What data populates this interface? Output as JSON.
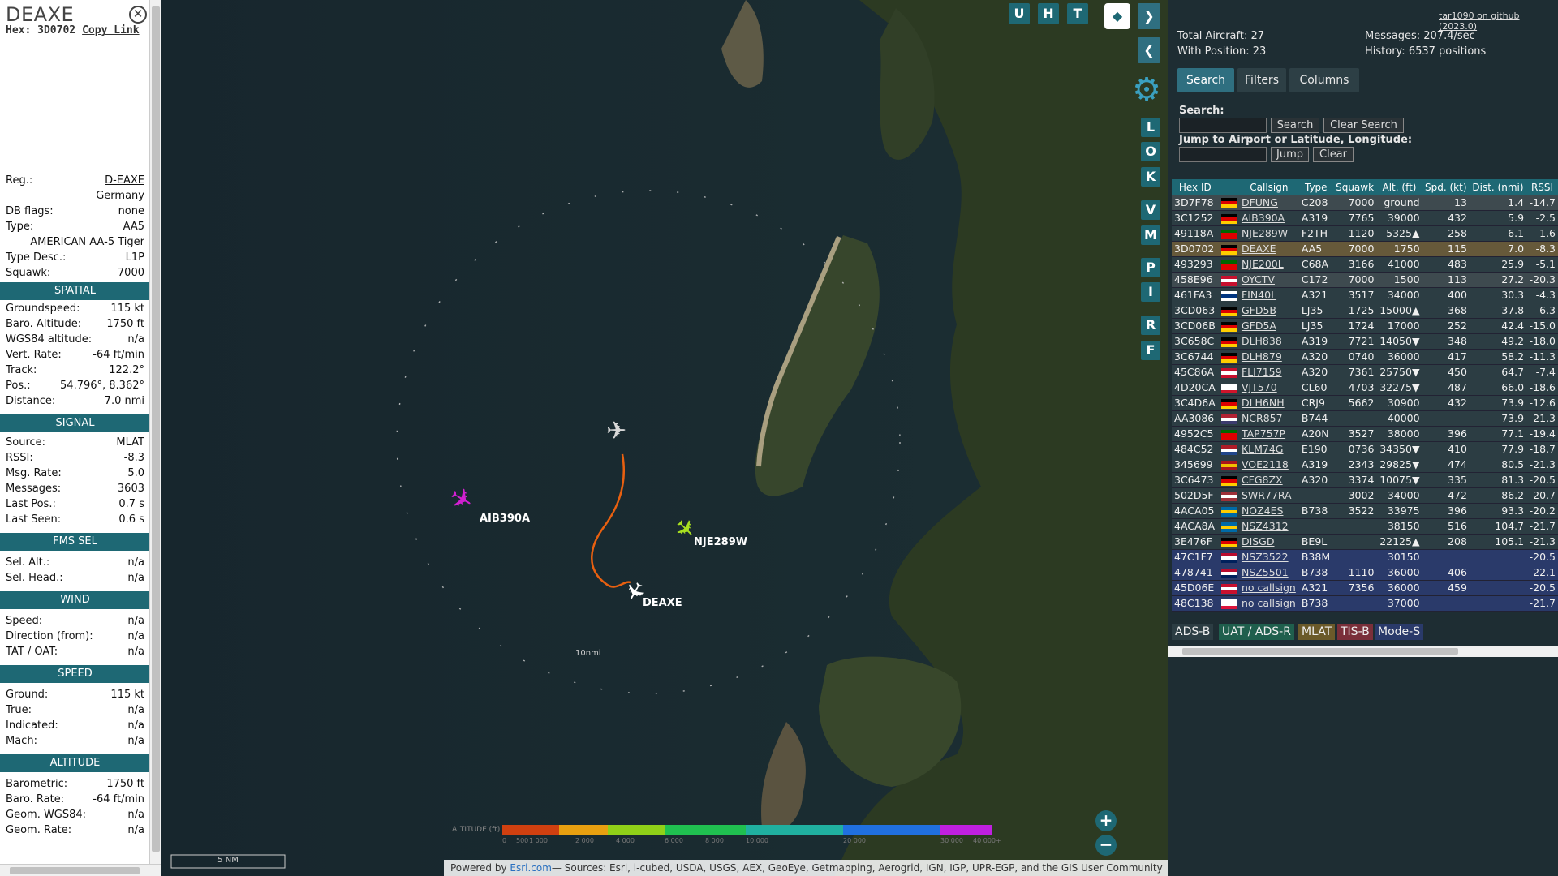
{
  "sidebar": {
    "title": "DEAXE",
    "hex_label": "Hex:",
    "hex": "3D0702",
    "copy_link": "Copy Link",
    "info": [
      {
        "k": "Reg.:",
        "v": "D-EAXE"
      },
      {
        "k": "",
        "v": "Germany"
      },
      {
        "k": "DB flags:",
        "v": "none"
      },
      {
        "k": "Type:",
        "v": "AA5"
      },
      {
        "k": "",
        "v": "AMERICAN AA-5 Tiger"
      },
      {
        "k": "Type Desc.:",
        "v": "L1P"
      },
      {
        "k": "Squawk:",
        "v": "7000"
      }
    ],
    "sections": {
      "spatial": "SPATIAL",
      "signal": "SIGNAL",
      "fms": "FMS SEL",
      "wind": "WIND",
      "speed": "SPEED",
      "altitude": "ALTITUDE"
    },
    "spatial": [
      {
        "k": "Groundspeed:",
        "v": "115 kt"
      },
      {
        "k": "Baro. Altitude:",
        "v": "1750 ft"
      },
      {
        "k": "WGS84 altitude:",
        "v": "n/a"
      },
      {
        "k": "Vert. Rate:",
        "v": "-64 ft/min"
      },
      {
        "k": "Track:",
        "v": "122.2°"
      },
      {
        "k": "Pos.:",
        "v": "54.796°, 8.362°"
      },
      {
        "k": "Distance:",
        "v": "7.0 nmi"
      }
    ],
    "signal": [
      {
        "k": "Source:",
        "v": "MLAT"
      },
      {
        "k": "RSSI:",
        "v": "-8.3"
      },
      {
        "k": "Msg. Rate:",
        "v": "5.0"
      },
      {
        "k": "Messages:",
        "v": "3603"
      },
      {
        "k": "Last Pos.:",
        "v": "0.7 s"
      },
      {
        "k": "Last Seen:",
        "v": "0.6 s"
      }
    ],
    "fms": [
      {
        "k": "Sel. Alt.:",
        "v": "n/a"
      },
      {
        "k": "Sel. Head.:",
        "v": "n/a"
      }
    ],
    "wind": [
      {
        "k": "Speed:",
        "v": "n/a"
      },
      {
        "k": "Direction (from):",
        "v": "n/a"
      },
      {
        "k": "TAT / OAT:",
        "v": "n/a"
      }
    ],
    "speed": [
      {
        "k": "Ground:",
        "v": "115 kt"
      },
      {
        "k": "True:",
        "v": "n/a"
      },
      {
        "k": "Indicated:",
        "v": "n/a"
      },
      {
        "k": "Mach:",
        "v": "n/a"
      }
    ],
    "altitude": [
      {
        "k": "Barometric:",
        "v": "1750 ft"
      },
      {
        "k": "Baro. Rate:",
        "v": "-64 ft/min"
      },
      {
        "k": "Geom. WGS84:",
        "v": "n/a"
      },
      {
        "k": "Geom. Rate:",
        "v": "n/a"
      }
    ]
  },
  "map": {
    "labels": {
      "aib": "AIB390A",
      "nje": "NJE289W",
      "deaxe": "DEAXE",
      "ring": "10nmi"
    },
    "top_buttons": [
      "U",
      "H",
      "T"
    ],
    "side_buttons": [
      "L",
      "O",
      "K",
      "V",
      "M",
      "P",
      "I",
      "R",
      "F"
    ],
    "scale": "5 NM",
    "alt_legend": {
      "title": "ALTITUDE (ft)",
      "ticks": [
        "0",
        "500",
        "1 000",
        "2 000",
        "4 000",
        "6 000",
        "8 000",
        "10 000",
        "20 000",
        "30 000",
        "40 000+"
      ]
    },
    "zoom_in": "+",
    "zoom_out": "−",
    "attrib_prefix": "Powered by ",
    "attrib_link": "Esri.com",
    "attrib_rest": "— Sources: Esri, i-cubed, USDA, USGS, AEX, GeoEye, Getmapping, Aerogrid, IGN, IGP, UPR-EGP, and the GIS User Community",
    "colors": {
      "aib": "#d020d0",
      "nje": "#a8e020",
      "deaxe": "#ffffff",
      "track": "#e86010"
    }
  },
  "panel": {
    "github": "tar1090 on github (2023.0)",
    "total": "Total Aircraft: 27",
    "withpos": "With Position: 23",
    "messages": "Messages: 207.4/sec",
    "history": "History: 6537 positions",
    "tabs": [
      "Search",
      "Filters",
      "Columns"
    ],
    "search_label": "Search:",
    "search_btn": "Search",
    "clear_search_btn": "Clear Search",
    "jump_label": "Jump to Airport or Latitude, Longitude:",
    "jump_btn": "Jump",
    "clear_btn": "Clear",
    "columns": [
      "Hex ID",
      "",
      "Callsign",
      "Type",
      "Squawk",
      "Alt. (ft)",
      "Spd. (kt)",
      "Dist. (nmi)",
      "RSSI"
    ],
    "rows": [
      {
        "hex": "3D7F78",
        "flag": "de",
        "cs": "DFUNG",
        "type": "C208",
        "sq": "7000",
        "alt": "ground",
        "spd": "13",
        "dist": "1.4",
        "rssi": "-14.7",
        "cls": "mlat"
      },
      {
        "hex": "3C1252",
        "flag": "de",
        "cs": "AIB390A",
        "type": "A319",
        "sq": "7765",
        "alt": "39000",
        "spd": "432",
        "dist": "5.9",
        "rssi": "-2.5",
        "cls": "adsb"
      },
      {
        "hex": "49118A",
        "flag": "pt",
        "cs": "NJE289W",
        "type": "F2TH",
        "sq": "1120",
        "alt": "5325▲",
        "spd": "258",
        "dist": "6.1",
        "rssi": "-1.6",
        "cls": "adsb"
      },
      {
        "hex": "3D0702",
        "flag": "de",
        "cs": "DEAXE",
        "type": "AA5",
        "sq": "7000",
        "alt": "1750",
        "spd": "115",
        "dist": "7.0",
        "rssi": "-8.3",
        "cls": "sel"
      },
      {
        "hex": "493293",
        "flag": "pt",
        "cs": "NJE200L",
        "type": "C68A",
        "sq": "3166",
        "alt": "41000",
        "spd": "483",
        "dist": "25.9",
        "rssi": "-5.1",
        "cls": "adsb"
      },
      {
        "hex": "458E96",
        "flag": "dk",
        "cs": "OYCTV",
        "type": "C172",
        "sq": "7000",
        "alt": "1500",
        "spd": "113",
        "dist": "27.2",
        "rssi": "-20.3",
        "cls": "mlat"
      },
      {
        "hex": "461FA3",
        "flag": "fi",
        "cs": "FIN40L",
        "type": "A321",
        "sq": "3517",
        "alt": "34000",
        "spd": "400",
        "dist": "30.3",
        "rssi": "-4.3",
        "cls": "adsb"
      },
      {
        "hex": "3CD063",
        "flag": "de",
        "cs": "GFD5B",
        "type": "LJ35",
        "sq": "1725",
        "alt": "15000▲",
        "spd": "368",
        "dist": "37.8",
        "rssi": "-6.3",
        "cls": "adsb"
      },
      {
        "hex": "3CD06B",
        "flag": "de",
        "cs": "GFD5A",
        "type": "LJ35",
        "sq": "1724",
        "alt": "17000",
        "spd": "252",
        "dist": "42.4",
        "rssi": "-15.0",
        "cls": "adsb"
      },
      {
        "hex": "3C658C",
        "flag": "de",
        "cs": "DLH838",
        "type": "A319",
        "sq": "7721",
        "alt": "14050▼",
        "spd": "348",
        "dist": "49.2",
        "rssi": "-18.0",
        "cls": "adsb"
      },
      {
        "hex": "3C6744",
        "flag": "de",
        "cs": "DLH879",
        "type": "A320",
        "sq": "0740",
        "alt": "36000",
        "spd": "417",
        "dist": "58.2",
        "rssi": "-11.3",
        "cls": "adsb"
      },
      {
        "hex": "45C86A",
        "flag": "dk",
        "cs": "FLI7159",
        "type": "A320",
        "sq": "7361",
        "alt": "25750▼",
        "spd": "450",
        "dist": "64.7",
        "rssi": "-7.4",
        "cls": "adsb"
      },
      {
        "hex": "4D20CA",
        "flag": "mt",
        "cs": "VJT570",
        "type": "CL60",
        "sq": "4703",
        "alt": "32275▼",
        "spd": "487",
        "dist": "66.0",
        "rssi": "-18.6",
        "cls": "adsb"
      },
      {
        "hex": "3C4D6A",
        "flag": "de",
        "cs": "DLH6NH",
        "type": "CRJ9",
        "sq": "5662",
        "alt": "30900",
        "spd": "432",
        "dist": "73.9",
        "rssi": "-12.6",
        "cls": "adsb"
      },
      {
        "hex": "AA3086",
        "flag": "us",
        "cs": "NCR857",
        "type": "B744",
        "sq": "",
        "alt": "40000",
        "spd": "",
        "dist": "73.9",
        "rssi": "-21.3",
        "cls": "adsb"
      },
      {
        "hex": "4952C5",
        "flag": "pt",
        "cs": "TAP757P",
        "type": "A20N",
        "sq": "3527",
        "alt": "38000",
        "spd": "396",
        "dist": "77.1",
        "rssi": "-19.4",
        "cls": "adsb"
      },
      {
        "hex": "484C52",
        "flag": "nl",
        "cs": "KLM74G",
        "type": "E190",
        "sq": "0736",
        "alt": "34350▼",
        "spd": "410",
        "dist": "77.9",
        "rssi": "-18.7",
        "cls": "adsb"
      },
      {
        "hex": "345699",
        "flag": "es",
        "cs": "VOE2118",
        "type": "A319",
        "sq": "2343",
        "alt": "29825▼",
        "spd": "474",
        "dist": "80.5",
        "rssi": "-21.3",
        "cls": "adsb"
      },
      {
        "hex": "3C6473",
        "flag": "de",
        "cs": "CFG8ZX",
        "type": "A320",
        "sq": "3374",
        "alt": "10075▼",
        "spd": "335",
        "dist": "81.3",
        "rssi": "-20.5",
        "cls": "adsb"
      },
      {
        "hex": "502D5F",
        "flag": "lv",
        "cs": "SWR77RA",
        "type": "",
        "sq": "3002",
        "alt": "34000",
        "spd": "472",
        "dist": "86.2",
        "rssi": "-20.7",
        "cls": "adsb"
      },
      {
        "hex": "4ACA05",
        "flag": "se",
        "cs": "NOZ4ES",
        "type": "B738",
        "sq": "3522",
        "alt": "33975",
        "spd": "396",
        "dist": "93.3",
        "rssi": "-20.2",
        "cls": "adsb"
      },
      {
        "hex": "4ACA8A",
        "flag": "se",
        "cs": "NSZ4312",
        "type": "",
        "sq": "",
        "alt": "38150",
        "spd": "516",
        "dist": "104.7",
        "rssi": "-21.7",
        "cls": "adsb"
      },
      {
        "hex": "3E476F",
        "flag": "de",
        "cs": "DISGD",
        "type": "BE9L",
        "sq": "",
        "alt": "22125▲",
        "spd": "208",
        "dist": "105.1",
        "rssi": "-21.3",
        "cls": "adsb"
      },
      {
        "hex": "47C1F7",
        "flag": "no",
        "cs": "NSZ3522",
        "type": "B38M",
        "sq": "",
        "alt": "30150",
        "spd": "",
        "dist": "",
        "rssi": "-20.5",
        "cls": "modes"
      },
      {
        "hex": "478741",
        "flag": "no",
        "cs": "NSZ5501",
        "type": "B738",
        "sq": "1110",
        "alt": "36000",
        "spd": "406",
        "dist": "",
        "rssi": "-22.1",
        "cls": "modes"
      },
      {
        "hex": "45D06E",
        "flag": "dk",
        "cs": "no callsign",
        "type": "A321",
        "sq": "7356",
        "alt": "36000",
        "spd": "459",
        "dist": "",
        "rssi": "-20.5",
        "cls": "modes"
      },
      {
        "hex": "48C138",
        "flag": "pl",
        "cs": "no callsign",
        "type": "B738",
        "sq": "",
        "alt": "37000",
        "spd": "",
        "dist": "",
        "rssi": "-21.7",
        "cls": "modes"
      }
    ],
    "legend": [
      "ADS-B",
      "UAT / ADS-R",
      "MLAT",
      "TIS-B",
      "Mode-S"
    ]
  }
}
